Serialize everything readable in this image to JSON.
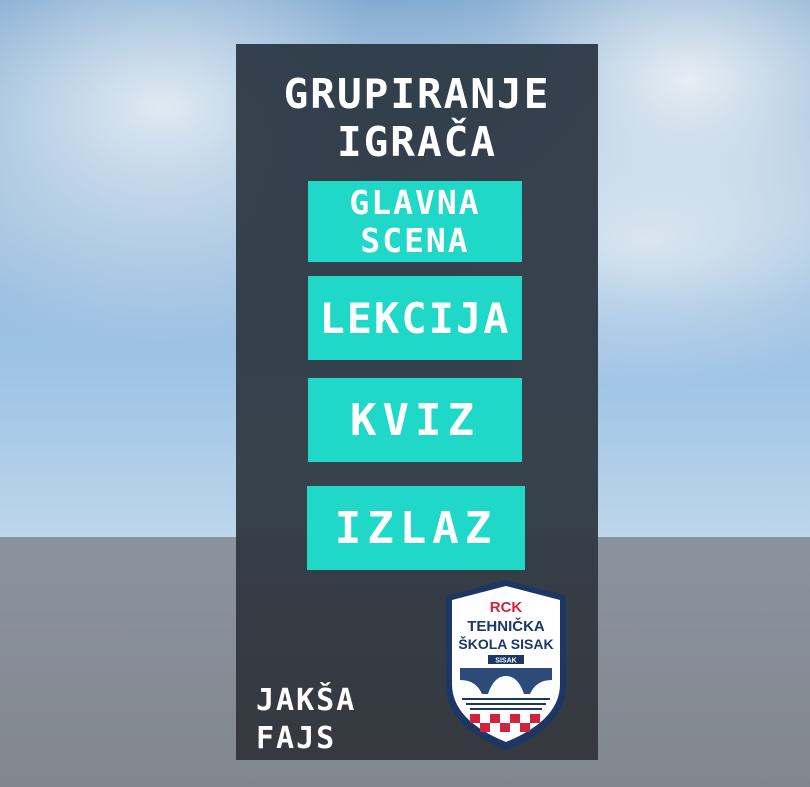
{
  "title": {
    "line1": "GRUPIRANJE",
    "line2": "IGRAČA"
  },
  "menu": {
    "main_scene_line1": "GLAVNA",
    "main_scene_line2": "SCENA",
    "lesson": "LEKCIJA",
    "quiz": "KVIZ",
    "exit": "IZLAZ"
  },
  "author": {
    "line1": "JAKŠA",
    "line2": "FAJS"
  },
  "logo": {
    "line1": "RCK",
    "line2": "TEHNIČKA",
    "line3": "ŠKOLA SISAK",
    "line4": "SISAK"
  },
  "colors": {
    "button": "#1fd8c8",
    "panel": "#2e3a46",
    "logo_red": "#d2233c",
    "logo_navy": "#1c3763"
  }
}
